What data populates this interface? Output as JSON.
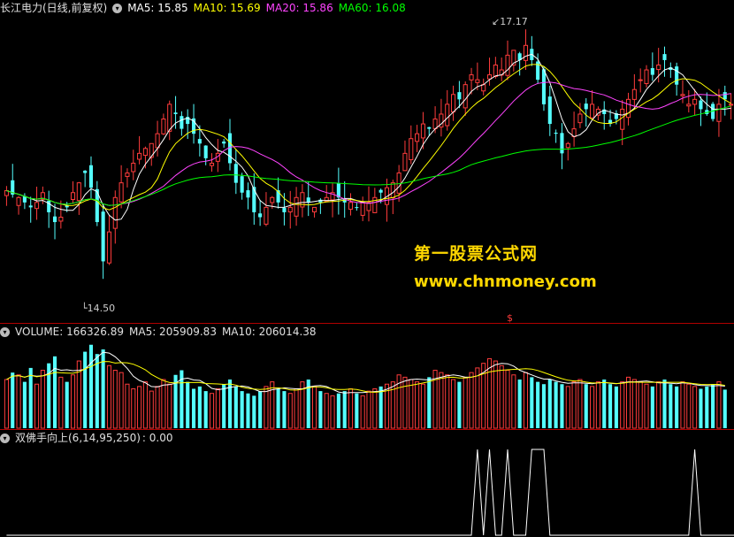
{
  "header": {
    "stock": "长江电力(日线,前复权)",
    "ma5": "MA5: 15.85",
    "ma10": "MA10: 15.69",
    "ma20": "MA20: 15.86",
    "ma60": "MA60: 16.08"
  },
  "volume_header": {
    "volume": "VOLUME: 166326.89",
    "ma5": "MA5: 205909.83",
    "ma10": "MA10: 206014.38"
  },
  "indicator_header": {
    "name": "双佛手向上(6,14,95,250)",
    "value": ": 0.00"
  },
  "watermark": {
    "cn": "第一股票公式网",
    "url": "www.chnmoney.com"
  },
  "annotations": {
    "high": "17.17",
    "low": "14.50",
    "marker": "$"
  },
  "colors": {
    "up": "#ff3c3c",
    "down": "#54ffff",
    "ma5": "#ffffff",
    "ma10": "#ffff00",
    "ma20": "#ff44ff",
    "ma60": "#00ff00",
    "divider": "#b00000",
    "watermark": "#ffd800"
  },
  "chart_data": [
    {
      "type": "candlestick",
      "title": "长江电力(日线,前复权)",
      "ylim": [
        14.3,
        17.4
      ],
      "series": [
        {
          "name": "MA5",
          "value": 15.85
        },
        {
          "name": "MA10",
          "value": 15.69
        },
        {
          "name": "MA20",
          "value": 15.86
        },
        {
          "name": "MA60",
          "value": 16.08
        }
      ],
      "close": [
        15.62,
        15.58,
        15.55,
        15.5,
        15.45,
        15.5,
        15.6,
        15.4,
        15.3,
        15.35,
        15.45,
        15.6,
        15.7,
        15.8,
        15.65,
        15.3,
        14.9,
        15.2,
        15.55,
        15.7,
        15.8,
        15.9,
        16.0,
        16.05,
        16.1,
        16.2,
        16.35,
        16.5,
        16.4,
        16.25,
        16.3,
        16.2,
        16.1,
        15.95,
        15.9,
        16.0,
        16.1,
        15.9,
        15.7,
        15.6,
        15.55,
        15.4,
        15.35,
        15.45,
        15.55,
        15.5,
        15.4,
        15.45,
        15.55,
        15.6,
        15.5,
        15.45,
        15.5,
        15.55,
        15.6,
        15.55,
        15.5,
        15.5,
        15.45,
        15.5,
        15.5,
        15.55,
        15.6,
        15.65,
        15.7,
        15.8,
        16.0,
        16.15,
        16.2,
        16.3,
        16.25,
        16.35,
        16.4,
        16.5,
        16.6,
        16.55,
        16.7,
        16.8,
        16.75,
        16.7,
        16.8,
        16.9,
        16.85,
        17.0,
        17.05,
        16.95,
        17.1,
        16.95,
        16.75,
        16.5,
        16.3,
        16.2,
        16.0,
        16.1,
        16.25,
        16.4,
        16.45,
        16.5,
        16.45,
        16.4,
        16.3,
        16.35,
        16.45,
        16.55,
        16.65,
        16.75,
        16.85,
        16.8,
        16.9,
        16.95,
        16.85,
        16.7,
        16.6,
        16.5,
        16.55,
        16.45,
        16.4,
        16.35,
        16.5,
        16.55,
        16.5
      ],
      "low_label": 14.5,
      "high_label": 17.17
    },
    {
      "type": "bar",
      "title": "VOLUME",
      "series": [
        {
          "name": "VOLUME",
          "value": 166326.89
        },
        {
          "name": "MA5",
          "value": 205909.83
        },
        {
          "name": "MA10",
          "value": 206014.38
        }
      ],
      "values": [
        210000,
        240000,
        230000,
        200000,
        260000,
        190000,
        250000,
        280000,
        310000,
        220000,
        200000,
        230000,
        290000,
        330000,
        360000,
        320000,
        340000,
        270000,
        250000,
        240000,
        190000,
        170000,
        180000,
        200000,
        160000,
        180000,
        210000,
        190000,
        230000,
        250000,
        200000,
        170000,
        180000,
        160000,
        150000,
        170000,
        190000,
        210000,
        180000,
        160000,
        150000,
        140000,
        160000,
        180000,
        200000,
        170000,
        160000,
        150000,
        170000,
        200000,
        210000,
        180000,
        160000,
        150000,
        140000,
        150000,
        160000,
        170000,
        150000,
        140000,
        160000,
        170000,
        180000,
        190000,
        200000,
        230000,
        220000,
        210000,
        200000,
        190000,
        220000,
        250000,
        240000,
        230000,
        210000,
        200000,
        220000,
        240000,
        260000,
        280000,
        300000,
        290000,
        270000,
        250000,
        230000,
        210000,
        240000,
        220000,
        200000,
        190000,
        210000,
        200000,
        190000,
        180000,
        200000,
        210000,
        190000,
        180000,
        200000,
        210000,
        190000,
        180000,
        200000,
        220000,
        210000,
        200000,
        190000,
        180000,
        200000,
        210000,
        190000,
        180000,
        200000,
        190000,
        180000,
        170000,
        180000,
        190000,
        200000,
        166326.89
      ]
    },
    {
      "type": "line",
      "title": "双佛手向上(6,14,95,250)",
      "values": [
        0,
        0,
        0,
        0,
        0,
        0,
        0,
        0,
        0,
        0,
        0,
        0,
        0,
        0,
        0,
        0,
        0,
        0,
        0,
        0,
        0,
        0,
        0,
        0,
        0,
        0,
        0,
        0,
        0,
        0,
        0,
        0,
        0,
        0,
        0,
        0,
        0,
        0,
        0,
        0,
        0,
        0,
        0,
        0,
        0,
        0,
        0,
        0,
        0,
        0,
        0,
        0,
        0,
        0,
        0,
        0,
        0,
        0,
        0,
        0,
        0,
        0,
        0,
        0,
        0,
        0,
        0,
        0,
        0,
        0,
        0,
        0,
        0,
        0,
        0,
        0,
        0,
        0,
        1,
        0,
        1,
        0,
        0,
        1,
        0,
        0,
        0,
        1,
        1,
        1,
        0,
        0,
        0,
        0,
        0,
        0,
        0,
        0,
        0,
        0,
        0,
        0,
        0,
        0,
        0,
        0,
        0,
        0,
        0,
        0,
        0,
        0,
        0,
        0,
        1,
        0,
        0,
        0,
        0,
        0,
        0,
        0,
        0
      ]
    }
  ]
}
